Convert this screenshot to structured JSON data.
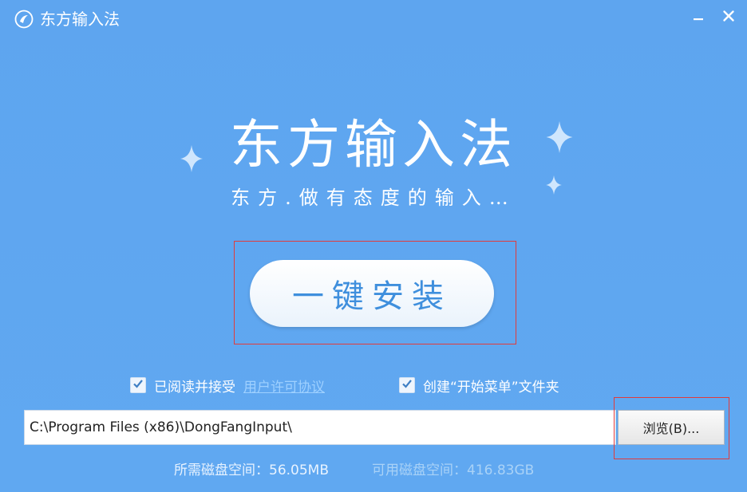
{
  "window": {
    "title": "东方输入法",
    "minimize_label": "–",
    "close_label": "✕"
  },
  "brand": {
    "title": "东方输入法",
    "slogan": "东方.做有态度的输入…"
  },
  "install": {
    "button_label": "一键安装"
  },
  "options": {
    "agree_label": "已阅读并接受",
    "license_link": "用户许可协议",
    "start_menu_label": "创建“开始菜单”文件夹"
  },
  "path": {
    "value": "C:\\Program Files (x86)\\DongFangInput\\",
    "browse_label": "浏览(B)..."
  },
  "disk": {
    "required": "所需磁盘空间：56.05MB",
    "available": "可用磁盘空间：416.83GB"
  },
  "colors": {
    "background": "#5fa6f0",
    "button_text": "#3f8fdd",
    "highlight_frame": "#e23b3b",
    "link": "#9ed0ff"
  },
  "icons": {
    "app": "dongfang-logo-icon",
    "minimize": "minimize-icon",
    "close": "close-icon",
    "sparkle": "sparkle-icon",
    "checkbox": "checkmark-icon"
  }
}
